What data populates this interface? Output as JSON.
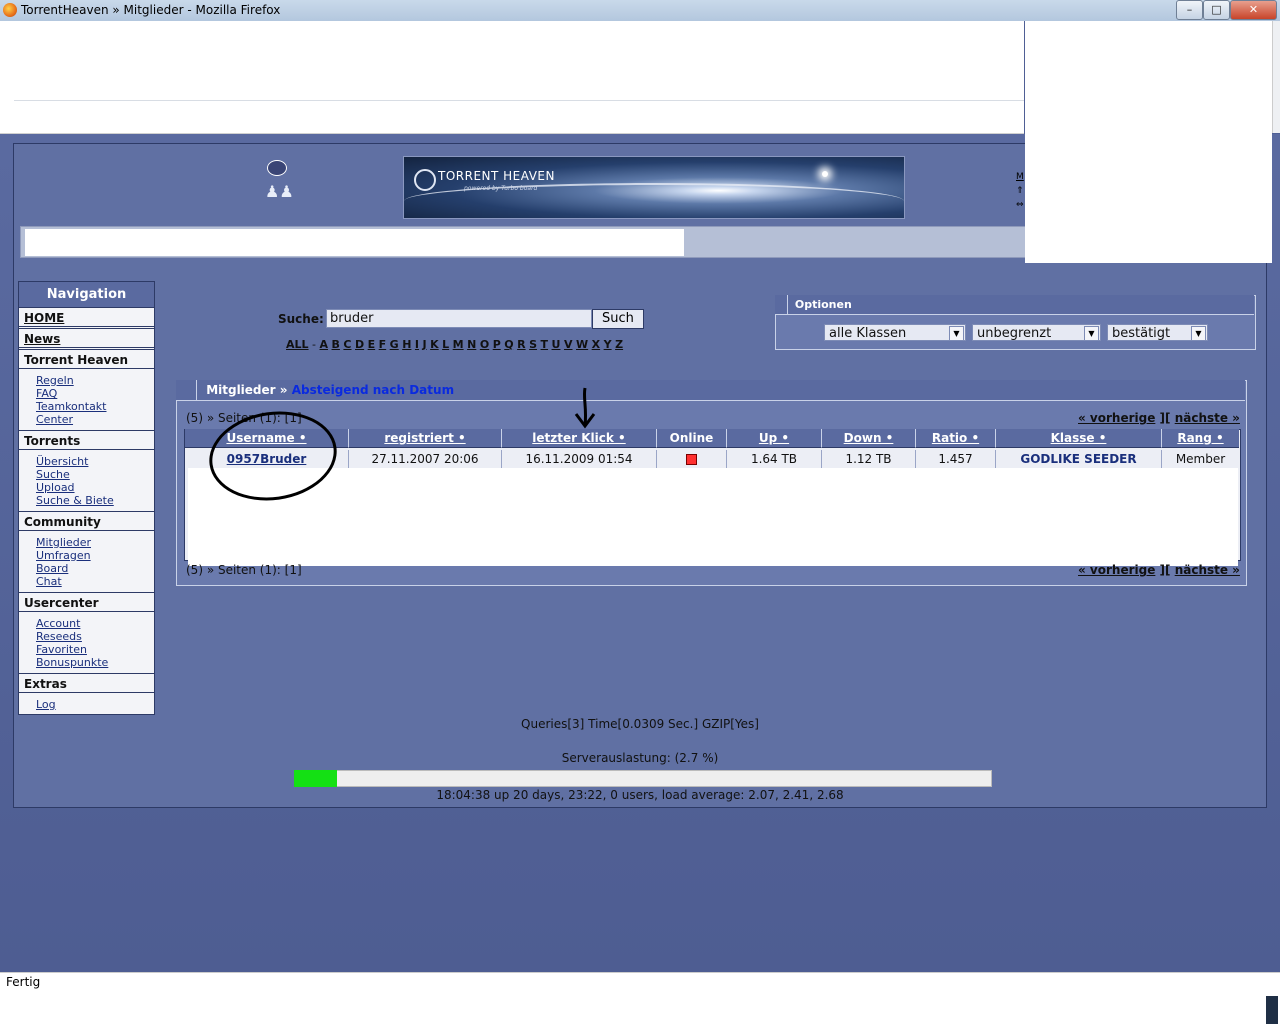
{
  "window": {
    "title": "TorrentHeaven » Mitglieder - Mozilla Firefox",
    "controls": {
      "minimize": "–",
      "maximize": "□",
      "close": "✕"
    }
  },
  "header": {
    "banner_title": "TORRENT HEAVEN",
    "banner_subtitle": "powered by Turbo board",
    "right_links": "M"
  },
  "navigation": {
    "title": "Navigation",
    "home": "HOME",
    "news": "News",
    "sections": [
      {
        "heading": "Torrent Heaven",
        "items": [
          "Regeln",
          "FAQ",
          "Teamkontakt",
          "Center"
        ]
      },
      {
        "heading": "Torrents",
        "items": [
          "Übersicht",
          "Suche",
          "Upload",
          "Suche & Biete"
        ]
      },
      {
        "heading": "Community",
        "items": [
          "Mitglieder",
          "Umfragen",
          "Board",
          "Chat"
        ]
      },
      {
        "heading": "Usercenter",
        "items": [
          "Account",
          "Reseeds",
          "Favoriten",
          "Bonuspunkte"
        ]
      },
      {
        "heading": "Extras",
        "items": [
          "Log"
        ]
      }
    ]
  },
  "search": {
    "label": "Suche:",
    "value": "bruder",
    "button": "Such",
    "alphabet": [
      "ALL",
      "A",
      "B",
      "C",
      "D",
      "E",
      "F",
      "G",
      "H",
      "I",
      "J",
      "K",
      "L",
      "M",
      "N",
      "O",
      "P",
      "Q",
      "R",
      "S",
      "T",
      "U",
      "V",
      "W",
      "X",
      "Y",
      "Z"
    ]
  },
  "options": {
    "title": "Optionen",
    "class_filter": "alle Klassen",
    "limit_filter": "unbegrenzt",
    "status_filter": "bestätigt"
  },
  "members": {
    "breadcrumb_root": "Mitglieder",
    "breadcrumb_sep": " » ",
    "sort_label": "Absteigend nach Datum",
    "pager": "(5) » Seiten (1): [1]",
    "prev": "« vorherige",
    "next": "nächste »",
    "columns": [
      "Username •",
      "registriert •",
      "letzter Klick •",
      "Online",
      "Up •",
      "Down •",
      "Ratio •",
      "Klasse •",
      "Rang •"
    ],
    "rows": [
      {
        "username": "0957Bruder",
        "registered": "27.11.2007 20:06",
        "last_click": "16.11.2009 01:54",
        "online": false,
        "up": "1.64 TB",
        "down": "1.12 TB",
        "ratio": "1.457",
        "class": "GODLIKE SEEDER",
        "rank": "Member"
      }
    ]
  },
  "footer": {
    "stats": "Queries[3] Time[0.0309 Sec.] GZIP[Yes]",
    "server_load_label": "Serverauslastung: (2.7 %)",
    "server_load_percent": 2.7,
    "uptime": "18:04:38 up 20 days, 23:22, 0 users, load average: 2.07, 2.41, 2.68"
  },
  "statusbar": {
    "text": "Fertig"
  },
  "colors": {
    "page_bg": "#4f5f95",
    "panel_header": "#5a6aa0",
    "link": "#1a2f7c",
    "load_fill": "#14e014"
  }
}
